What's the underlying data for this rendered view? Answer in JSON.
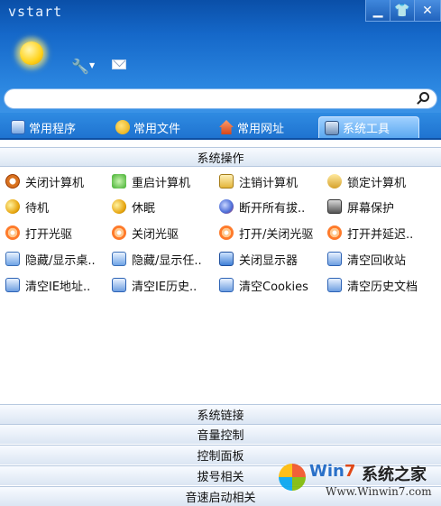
{
  "window": {
    "title": "vstart",
    "controls": [
      "minimize-icon",
      "skin-icon",
      "close-icon"
    ]
  },
  "toolbar": {
    "icons": [
      "weather-sun-icon",
      "wrench-icon",
      "mail-icon"
    ]
  },
  "search": {
    "value": "",
    "placeholder": ""
  },
  "tabs": [
    {
      "label": "常用程序",
      "icon": "document-icon",
      "active": false
    },
    {
      "label": "常用文件",
      "icon": "apple-icon",
      "active": false
    },
    {
      "label": "常用网址",
      "icon": "home-icon",
      "active": false
    },
    {
      "label": "系统工具",
      "icon": "tools-icon",
      "active": true
    }
  ],
  "section": {
    "title": "系统操作",
    "items": [
      {
        "label": "关闭计算机",
        "icon": "power-icon"
      },
      {
        "label": "重启计算机",
        "icon": "restart-icon"
      },
      {
        "label": "注销计算机",
        "icon": "logoff-icon"
      },
      {
        "label": "锁定计算机",
        "icon": "lock-icon"
      },
      {
        "label": "待机",
        "icon": "standby-icon"
      },
      {
        "label": "休眠",
        "icon": "hibernate-icon"
      },
      {
        "label": "断开所有拔..",
        "icon": "disconnect-icon"
      },
      {
        "label": "屏幕保护",
        "icon": "screensaver-icon"
      },
      {
        "label": "打开光驱",
        "icon": "cdrom-open-icon"
      },
      {
        "label": "关闭光驱",
        "icon": "cdrom-close-icon"
      },
      {
        "label": "打开/关闭光驱",
        "icon": "cdrom-toggle-icon"
      },
      {
        "label": "打开并延迟..",
        "icon": "cdrom-delay-icon"
      },
      {
        "label": "隐藏/显示桌..",
        "icon": "desktop-toggle-icon"
      },
      {
        "label": "隐藏/显示任..",
        "icon": "taskbar-toggle-icon"
      },
      {
        "label": "关闭显示器",
        "icon": "monitor-icon"
      },
      {
        "label": "清空回收站",
        "icon": "recycle-icon"
      },
      {
        "label": "清空IE地址..",
        "icon": "ie-address-icon"
      },
      {
        "label": "清空IE历史..",
        "icon": "ie-history-icon"
      },
      {
        "label": "清空Cookies",
        "icon": "cookies-icon"
      },
      {
        "label": "清空历史文档",
        "icon": "history-docs-icon"
      }
    ]
  },
  "collapsed_sections": [
    "系统链接",
    "音量控制",
    "控制面板",
    "拔号相关",
    "音速启动相关"
  ],
  "watermark": {
    "brand_a": "Win",
    "brand_b": "7",
    "brand_cn": "系统之家",
    "url": "Www.Winwin7.com"
  }
}
